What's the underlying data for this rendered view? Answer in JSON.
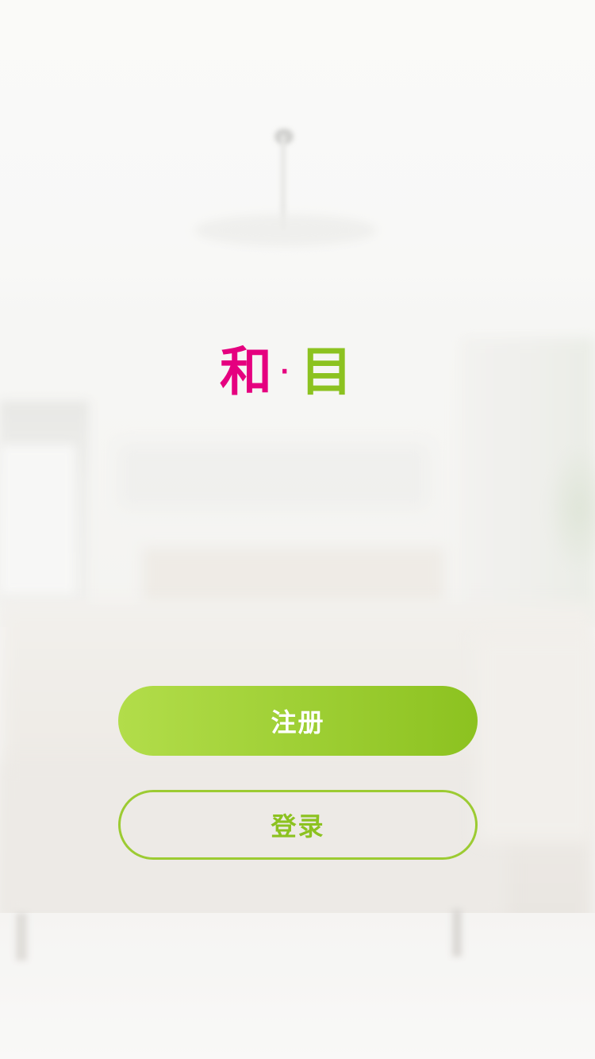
{
  "app": {
    "logo": {
      "part_left": "和",
      "separator": "·",
      "part_right": "目",
      "colors": {
        "left": "#e5007f",
        "separator": "#e5007f",
        "right": "#8cc220"
      }
    }
  },
  "actions": {
    "register_label": "注册",
    "login_label": "登录"
  },
  "theme": {
    "register_gradient_start": "#b2dd4a",
    "register_gradient_end": "#8cc220",
    "login_border": "#9ccb32",
    "login_text": "#8cc220"
  }
}
